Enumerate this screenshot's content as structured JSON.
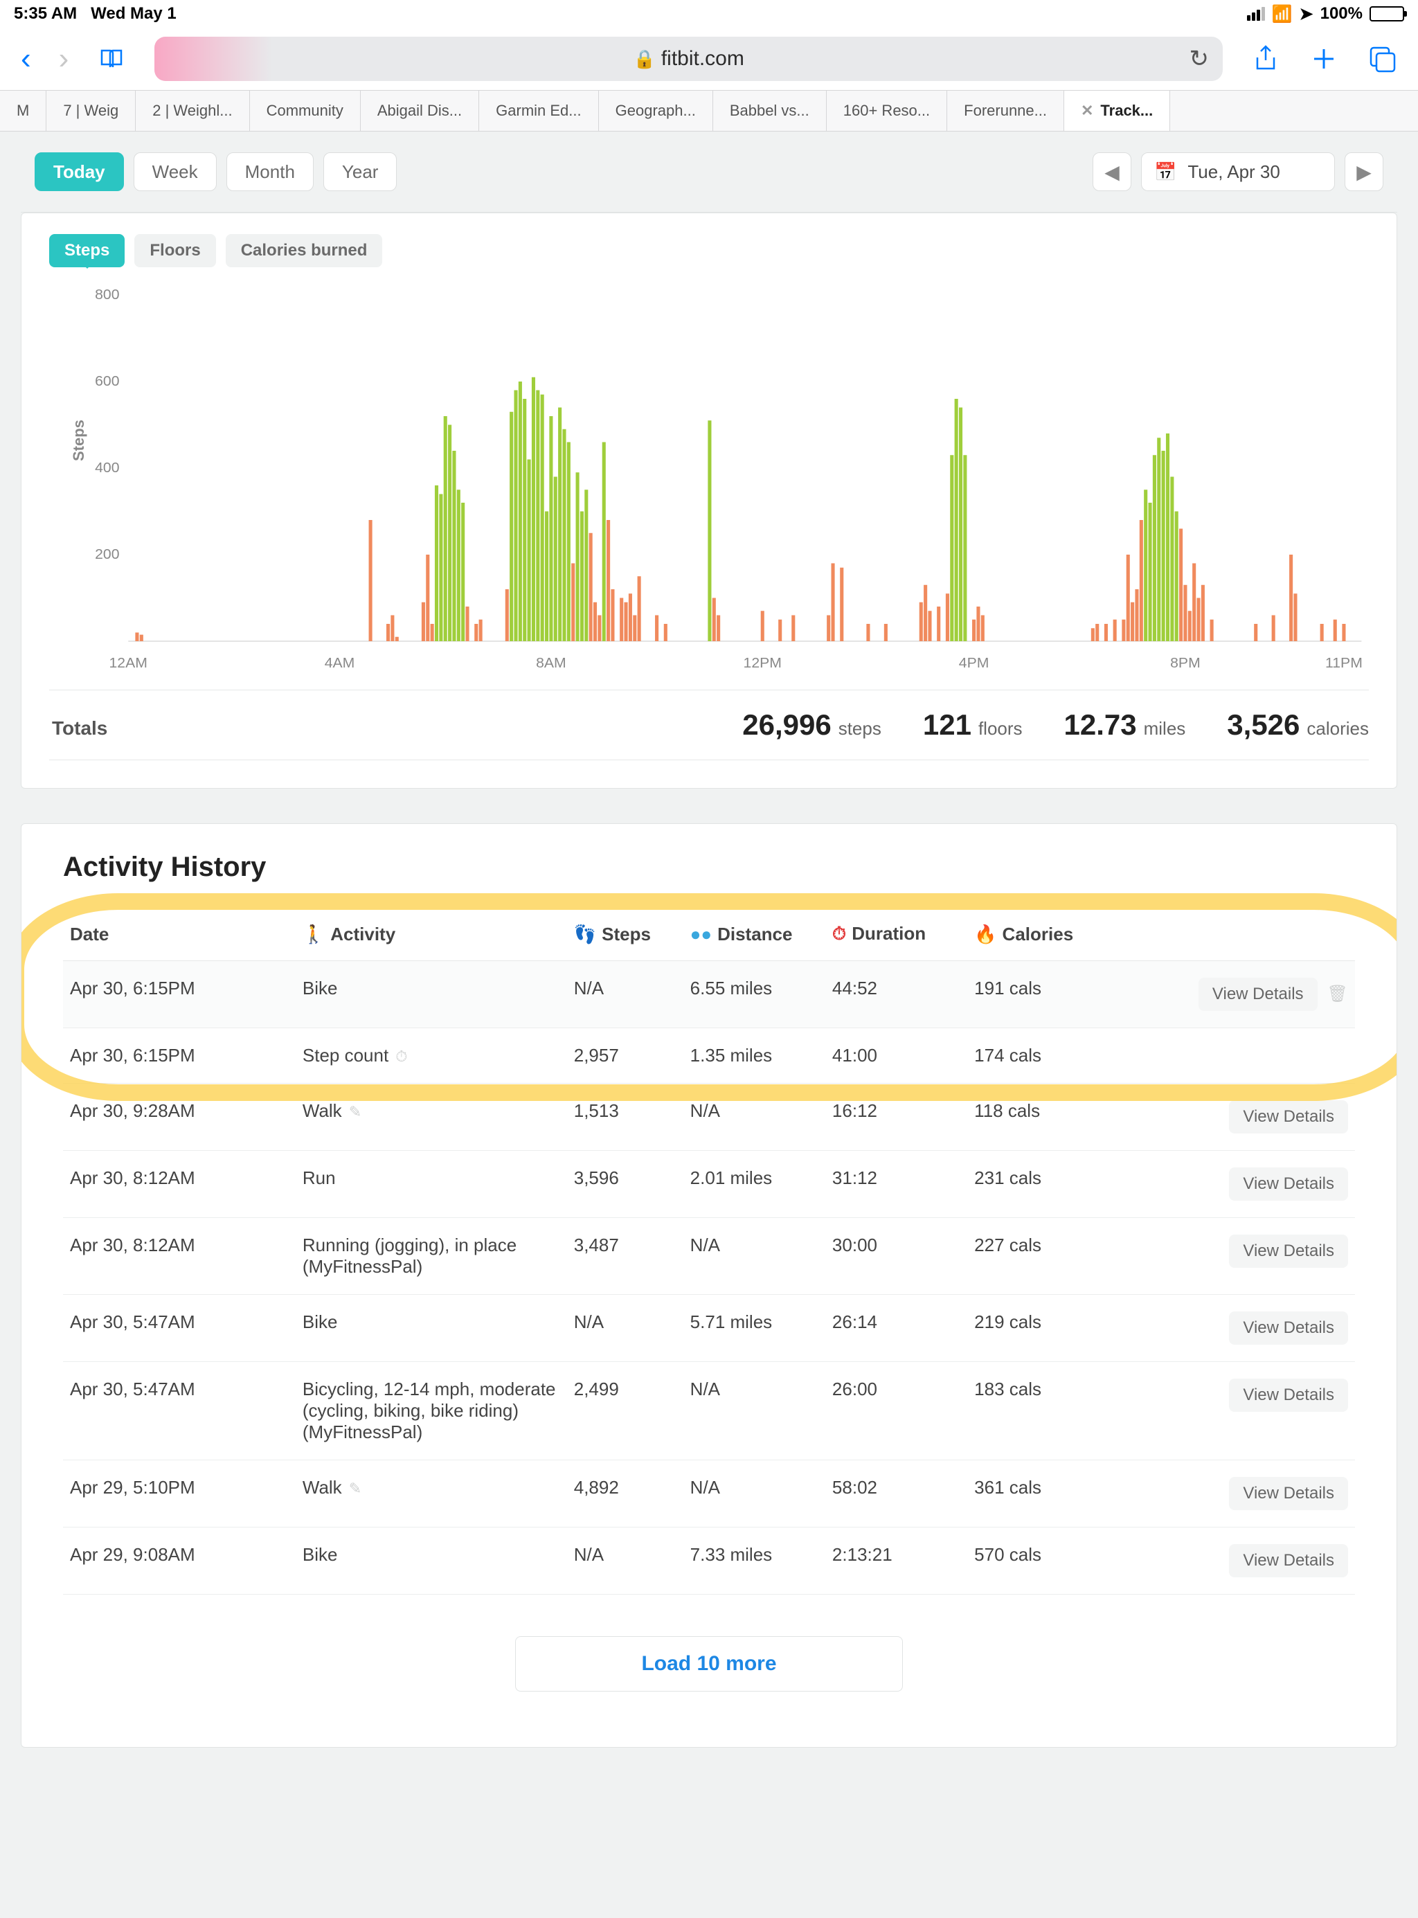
{
  "status": {
    "time": "5:35 AM",
    "date": "Wed May 1",
    "battery_pct": "100%"
  },
  "safari": {
    "url_host": "fitbit.com",
    "tabs": [
      {
        "label": "M"
      },
      {
        "label": "7 | Weig"
      },
      {
        "label": "2 | Weighl..."
      },
      {
        "label": "Community"
      },
      {
        "label": "Abigail Dis..."
      },
      {
        "label": "Garmin Ed..."
      },
      {
        "label": "Geograph..."
      },
      {
        "label": "Babbel vs..."
      },
      {
        "label": "160+ Reso..."
      },
      {
        "label": "Forerunne..."
      },
      {
        "label": "Track...",
        "active": true
      }
    ]
  },
  "period": {
    "today": "Today",
    "week": "Week",
    "month": "Month",
    "year": "Year",
    "date_display": "Tue, Apr 30"
  },
  "chips": {
    "steps": "Steps",
    "floors": "Floors",
    "calories": "Calories burned"
  },
  "totals": {
    "label": "Totals",
    "steps_num": "26,996",
    "steps_unit": "steps",
    "floors_num": "121",
    "floors_unit": "floors",
    "miles_num": "12.73",
    "miles_unit": "miles",
    "cal_num": "3,526",
    "cal_unit": "calories"
  },
  "history": {
    "title": "Activity History",
    "headers": {
      "date": "Date",
      "activity": "Activity",
      "steps": "Steps",
      "distance": "Distance",
      "duration": "Duration",
      "calories": "Calories"
    },
    "view_label": "View Details",
    "rows": [
      {
        "date": "Apr 30, 6:15PM",
        "activity": "Bike",
        "steps": "N/A",
        "distance": "6.55 miles",
        "duration": "44:52",
        "calories": "191 cals",
        "view": true,
        "trash": true,
        "sel": true
      },
      {
        "date": "Apr 30, 6:15PM",
        "activity": "Step count",
        "steps": "2,957",
        "distance": "1.35 miles",
        "duration": "41:00",
        "calories": "174 cals",
        "stopwatch": true
      },
      {
        "date": "Apr 30, 9:28AM",
        "activity": "Walk",
        "steps": "1,513",
        "distance": "N/A",
        "duration": "16:12",
        "calories": "118 cals",
        "view": true,
        "pencil": true
      },
      {
        "date": "Apr 30, 8:12AM",
        "activity": "Run",
        "steps": "3,596",
        "distance": "2.01 miles",
        "duration": "31:12",
        "calories": "231 cals",
        "view": true
      },
      {
        "date": "Apr 30, 8:12AM",
        "activity": "Running (jogging), in place (MyFitnessPal)",
        "steps": "3,487",
        "distance": "N/A",
        "duration": "30:00",
        "calories": "227 cals",
        "view": true
      },
      {
        "date": "Apr 30, 5:47AM",
        "activity": "Bike",
        "steps": "N/A",
        "distance": "5.71 miles",
        "duration": "26:14",
        "calories": "219 cals",
        "view": true
      },
      {
        "date": "Apr 30, 5:47AM",
        "activity": "Bicycling, 12-14 mph, moderate (cycling, biking, bike riding) (MyFitnessPal)",
        "steps": "2,499",
        "distance": "N/A",
        "duration": "26:00",
        "calories": "183 cals",
        "view": true
      },
      {
        "date": "Apr 29, 5:10PM",
        "activity": "Walk",
        "steps": "4,892",
        "distance": "N/A",
        "duration": "58:02",
        "calories": "361 cals",
        "view": true,
        "pencil": true
      },
      {
        "date": "Apr 29, 9:08AM",
        "activity": "Bike",
        "steps": "N/A",
        "distance": "7.33 miles",
        "duration": "2:13:21",
        "calories": "570 cals",
        "view": true
      }
    ],
    "load_more": "Load 10 more"
  },
  "chart_data": {
    "type": "bar",
    "title": "Steps per 5-min interval",
    "xlabel": "",
    "ylabel": "Steps",
    "ylim": [
      0,
      800
    ],
    "y_ticks": [
      200,
      400,
      600,
      800
    ],
    "x_ticks": [
      "12AM",
      "4AM",
      "8AM",
      "12PM",
      "4PM",
      "8PM",
      "11PM"
    ],
    "comment": "values are estimated 5-minute-bin step counts read from the chart pixels; green bars ≳300, orange <300 (approximate visual threshold)",
    "x_minutes_per_bin": 5,
    "x_start_minute": 0,
    "bars": [
      {
        "m": 10,
        "v": 20
      },
      {
        "m": 15,
        "v": 15
      },
      {
        "m": 275,
        "v": 280
      },
      {
        "m": 295,
        "v": 40
      },
      {
        "m": 300,
        "v": 60
      },
      {
        "m": 305,
        "v": 10
      },
      {
        "m": 335,
        "v": 90
      },
      {
        "m": 340,
        "v": 200
      },
      {
        "m": 345,
        "v": 40
      },
      {
        "m": 350,
        "v": 360
      },
      {
        "m": 355,
        "v": 340
      },
      {
        "m": 360,
        "v": 520
      },
      {
        "m": 365,
        "v": 500
      },
      {
        "m": 370,
        "v": 440
      },
      {
        "m": 375,
        "v": 350
      },
      {
        "m": 380,
        "v": 320
      },
      {
        "m": 385,
        "v": 80
      },
      {
        "m": 395,
        "v": 40
      },
      {
        "m": 400,
        "v": 50
      },
      {
        "m": 430,
        "v": 120
      },
      {
        "m": 435,
        "v": 530
      },
      {
        "m": 440,
        "v": 580
      },
      {
        "m": 445,
        "v": 600
      },
      {
        "m": 450,
        "v": 560
      },
      {
        "m": 455,
        "v": 420
      },
      {
        "m": 460,
        "v": 610
      },
      {
        "m": 465,
        "v": 580
      },
      {
        "m": 470,
        "v": 570
      },
      {
        "m": 475,
        "v": 300
      },
      {
        "m": 480,
        "v": 520
      },
      {
        "m": 485,
        "v": 380
      },
      {
        "m": 490,
        "v": 540
      },
      {
        "m": 495,
        "v": 490
      },
      {
        "m": 500,
        "v": 460
      },
      {
        "m": 505,
        "v": 180
      },
      {
        "m": 510,
        "v": 390
      },
      {
        "m": 515,
        "v": 300
      },
      {
        "m": 520,
        "v": 350
      },
      {
        "m": 525,
        "v": 250
      },
      {
        "m": 530,
        "v": 90
      },
      {
        "m": 535,
        "v": 60
      },
      {
        "m": 540,
        "v": 460
      },
      {
        "m": 545,
        "v": 280
      },
      {
        "m": 550,
        "v": 120
      },
      {
        "m": 560,
        "v": 100
      },
      {
        "m": 565,
        "v": 90
      },
      {
        "m": 570,
        "v": 110
      },
      {
        "m": 575,
        "v": 60
      },
      {
        "m": 580,
        "v": 150
      },
      {
        "m": 600,
        "v": 60
      },
      {
        "m": 610,
        "v": 40
      },
      {
        "m": 660,
        "v": 510
      },
      {
        "m": 665,
        "v": 100
      },
      {
        "m": 670,
        "v": 60
      },
      {
        "m": 720,
        "v": 70
      },
      {
        "m": 740,
        "v": 50
      },
      {
        "m": 755,
        "v": 60
      },
      {
        "m": 795,
        "v": 60
      },
      {
        "m": 800,
        "v": 180
      },
      {
        "m": 810,
        "v": 170
      },
      {
        "m": 840,
        "v": 40
      },
      {
        "m": 860,
        "v": 40
      },
      {
        "m": 900,
        "v": 90
      },
      {
        "m": 905,
        "v": 130
      },
      {
        "m": 910,
        "v": 70
      },
      {
        "m": 920,
        "v": 80
      },
      {
        "m": 930,
        "v": 110
      },
      {
        "m": 935,
        "v": 430
      },
      {
        "m": 940,
        "v": 560
      },
      {
        "m": 945,
        "v": 540
      },
      {
        "m": 950,
        "v": 430
      },
      {
        "m": 960,
        "v": 50
      },
      {
        "m": 965,
        "v": 80
      },
      {
        "m": 970,
        "v": 60
      },
      {
        "m": 1095,
        "v": 30
      },
      {
        "m": 1100,
        "v": 40
      },
      {
        "m": 1110,
        "v": 40
      },
      {
        "m": 1120,
        "v": 50
      },
      {
        "m": 1130,
        "v": 50
      },
      {
        "m": 1135,
        "v": 200
      },
      {
        "m": 1140,
        "v": 90
      },
      {
        "m": 1145,
        "v": 120
      },
      {
        "m": 1150,
        "v": 280
      },
      {
        "m": 1155,
        "v": 350
      },
      {
        "m": 1160,
        "v": 320
      },
      {
        "m": 1165,
        "v": 430
      },
      {
        "m": 1170,
        "v": 470
      },
      {
        "m": 1175,
        "v": 440
      },
      {
        "m": 1180,
        "v": 480
      },
      {
        "m": 1185,
        "v": 380
      },
      {
        "m": 1190,
        "v": 300
      },
      {
        "m": 1195,
        "v": 260
      },
      {
        "m": 1200,
        "v": 130
      },
      {
        "m": 1205,
        "v": 70
      },
      {
        "m": 1210,
        "v": 180
      },
      {
        "m": 1215,
        "v": 100
      },
      {
        "m": 1220,
        "v": 130
      },
      {
        "m": 1230,
        "v": 50
      },
      {
        "m": 1280,
        "v": 40
      },
      {
        "m": 1300,
        "v": 60
      },
      {
        "m": 1320,
        "v": 200
      },
      {
        "m": 1325,
        "v": 110
      },
      {
        "m": 1355,
        "v": 40
      },
      {
        "m": 1370,
        "v": 50
      },
      {
        "m": 1380,
        "v": 40
      }
    ]
  }
}
